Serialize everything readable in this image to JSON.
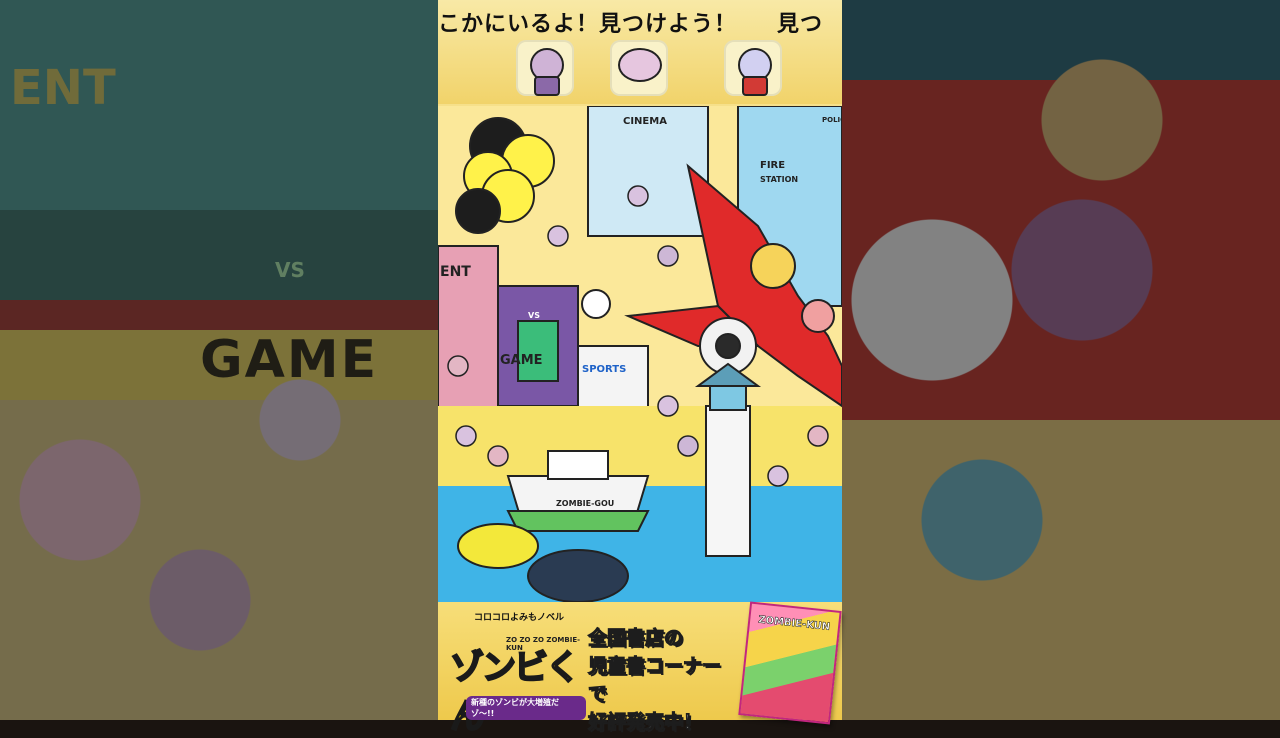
{
  "ticker": {
    "text_a": "こかにいるよ！見つけよう！",
    "text_b": "見つ"
  },
  "targets": [
    {
      "icon": "zombie-kid-target-icon"
    },
    {
      "icon": "zombie-blob-target-icon"
    },
    {
      "icon": "zombie-robot-target-icon"
    }
  ],
  "scene": {
    "labels": {
      "cinema": "CINEMA",
      "fire": "FIRE",
      "station": "STATION",
      "game": "GAME",
      "sports": "SPORTS",
      "ent": "ENT",
      "vs": "VS",
      "ship": "ZOMBIE-GOU",
      "police": "POLICE"
    }
  },
  "footer": {
    "logo_sub": "コロコロよみもノベル",
    "logo_en": "ZO ZO ZO ZOMBIE-KUN",
    "logo_main": "ゾンビくん",
    "logo_tag": "新種のゾンビが大増殖だゾ〜!!",
    "promo_line1": "全国書店の",
    "promo_line2": "児童書コーナーで",
    "promo_line3": "好評発売中！",
    "book_title": "ZOMBIE-KUN"
  },
  "side": {
    "left_game": "GAME",
    "left_vs": "VS",
    "left_ent": "ENT"
  }
}
